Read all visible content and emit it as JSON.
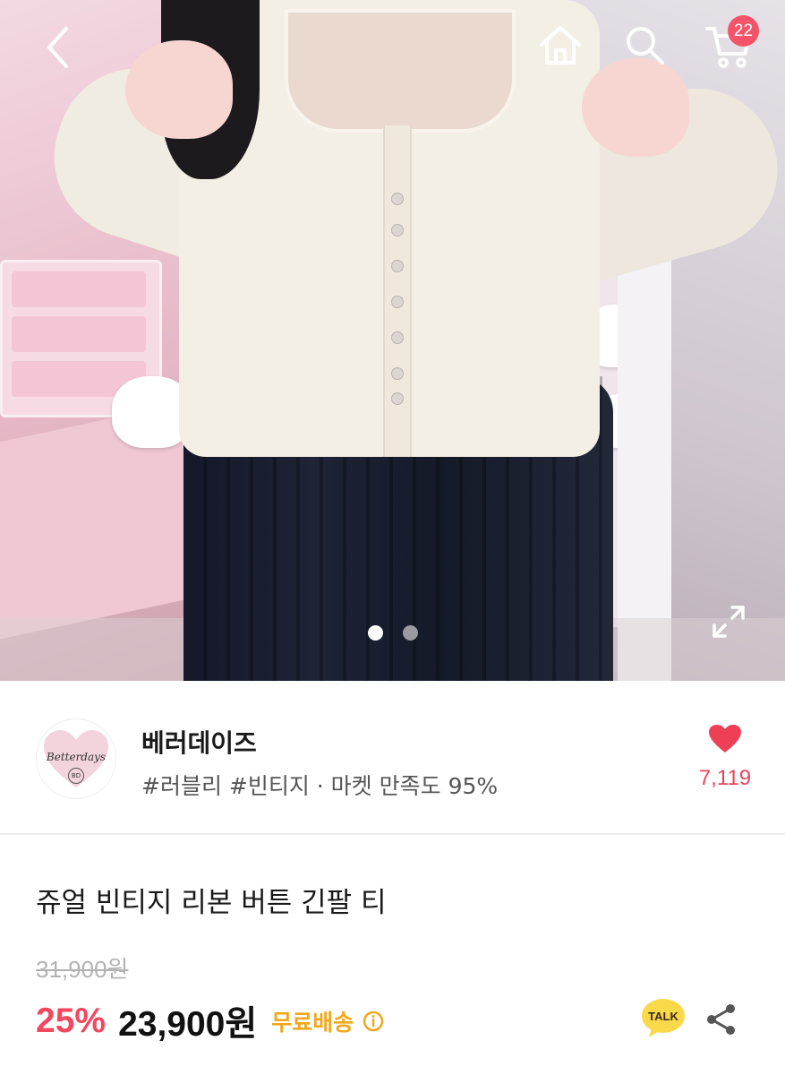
{
  "header": {
    "back_icon": "chevron-left-icon",
    "home_icon": "home-icon",
    "search_icon": "search-icon",
    "cart_icon": "cart-icon",
    "cart_count": "22"
  },
  "gallery": {
    "total_images": 2,
    "active_index": 0,
    "expand_icon": "expand-icon"
  },
  "seller": {
    "logo_text": "Betterdays",
    "logo_sub": "BD",
    "name": "베러데이즈",
    "tags": "#러블리 #빈티지 · 마켓 만족도 95%",
    "like_count": "7,119"
  },
  "product": {
    "title": "쥬얼 빈티지 리본 버튼 긴팔 티",
    "original_price": "31,900원",
    "discount": "25%",
    "price": "23,900원",
    "shipping": "무료배송"
  },
  "actions": {
    "talk_label": "TALK",
    "share_icon": "share-icon"
  },
  "colors": {
    "accent_red": "#f2475f",
    "badge_red": "#f3546a",
    "shipping_orange": "#f0a81e",
    "talk_yellow": "#f9d849"
  }
}
